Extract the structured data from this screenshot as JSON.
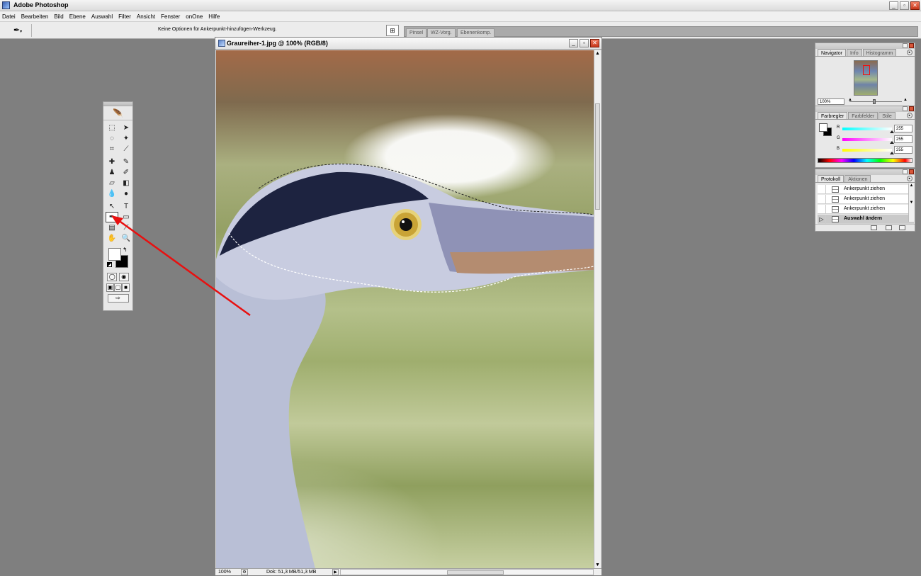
{
  "app": {
    "title": "Adobe Photoshop"
  },
  "menu": [
    "Datei",
    "Bearbeiten",
    "Bild",
    "Ebene",
    "Auswahl",
    "Filter",
    "Ansicht",
    "Fenster",
    "onOne",
    "Hilfe"
  ],
  "options_bar": {
    "hint": "Keine Optionen für Ankerpunkt-hinzufügen-Werkzeug.",
    "palette_well_tabs": [
      "Pinsel",
      "WZ-Vorg.",
      "Ebenenkomp."
    ]
  },
  "document": {
    "title": "Graureiher-1.jpg @ 100% (RGB/8)",
    "zoom": "100%",
    "doc_info": "Dok: 51,3 MB/51,3 MB"
  },
  "navigator": {
    "tabs": [
      "Navigator",
      "Info",
      "Histogramm"
    ],
    "zoom": "100%"
  },
  "color_panel": {
    "tabs": [
      "Farbregler",
      "Farbfelder",
      "Stile"
    ],
    "channels": [
      {
        "label": "R",
        "value": "255",
        "start": "#00ffff",
        "end": "#ffffff"
      },
      {
        "label": "G",
        "value": "255",
        "start": "#ff00ff",
        "end": "#ffffff"
      },
      {
        "label": "B",
        "value": "255",
        "start": "#ffff00",
        "end": "#ffffff"
      }
    ]
  },
  "history_panel": {
    "tabs": [
      "Protokoll",
      "Aktionen"
    ],
    "items": [
      {
        "label": "Ankerpunkt ziehen",
        "selected": false
      },
      {
        "label": "Ankerpunkt ziehen",
        "selected": false
      },
      {
        "label": "Ankerpunkt ziehen",
        "selected": false
      },
      {
        "label": "Auswahl ändern",
        "selected": true
      }
    ]
  },
  "colors": {
    "annotation_arrow": "#e81010",
    "foreground": "#ffffff",
    "background": "#000000"
  }
}
